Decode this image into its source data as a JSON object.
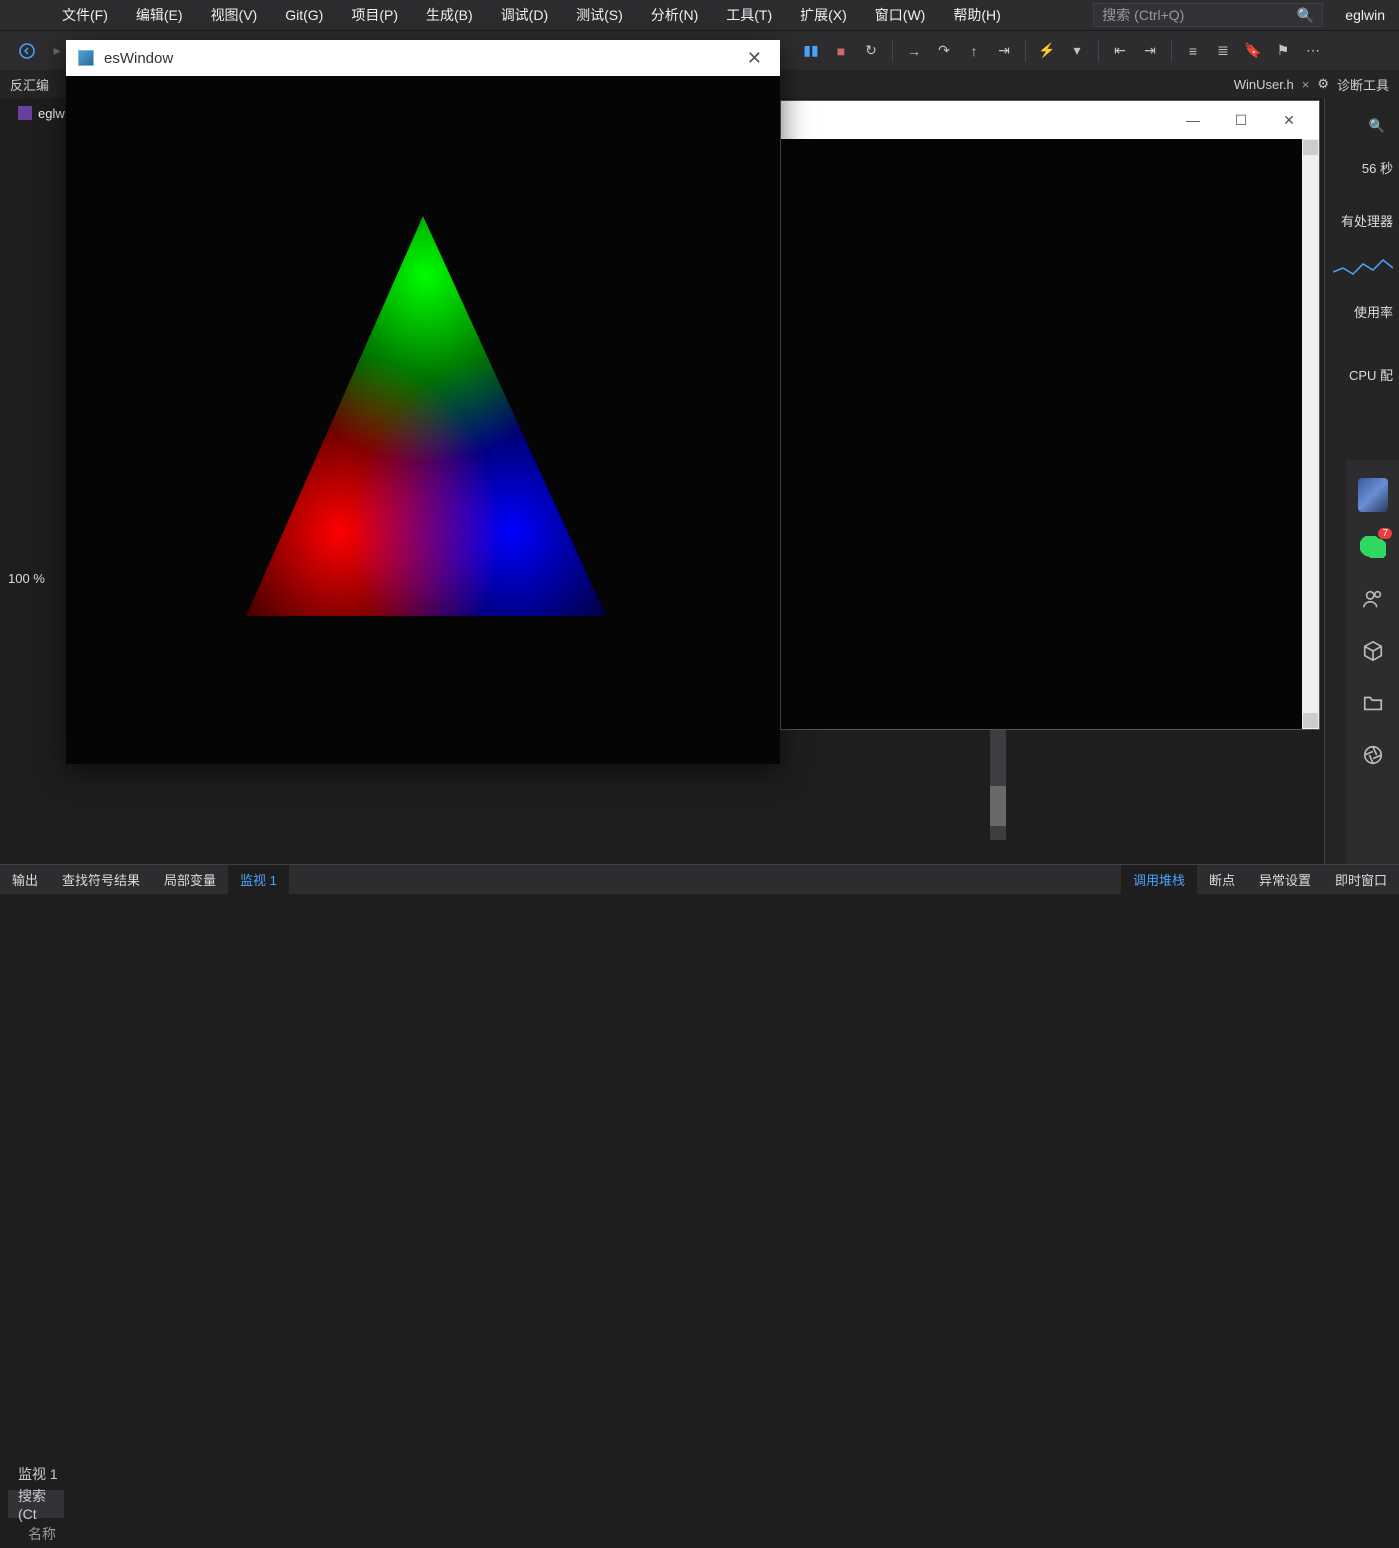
{
  "menubar": {
    "items": [
      "文件(F)",
      "编辑(E)",
      "视图(V)",
      "Git(G)",
      "项目(P)",
      "生成(B)",
      "调试(D)",
      "测试(S)",
      "分析(N)",
      "工具(T)",
      "扩展(X)",
      "窗口(W)",
      "帮助(H)"
    ],
    "search_placeholder": "搜索 (Ctrl+Q)",
    "user": "eglwin"
  },
  "tabbar": {
    "left_label": "反汇编",
    "right_file": "WinUser.h",
    "right_tool": "诊断工具"
  },
  "filetab": {
    "name": "eglw"
  },
  "right_panel": {
    "time": "56 秒",
    "proc": "有处理器",
    "cpu_use": "使用率",
    "cpu_cfg": "CPU 配"
  },
  "pct": "100 %",
  "bottom_left": {
    "watch": "监视 1",
    "search": "搜索(Ct",
    "name": "名称"
  },
  "bottom_strip": {
    "left": [
      "输出",
      "查找符号结果",
      "局部变量",
      "监视 1"
    ],
    "right": [
      "调用堆栈",
      "断点",
      "异常设置",
      "即时窗口"
    ]
  },
  "es_window": {
    "title": "esWindow"
  },
  "dock": {
    "wechat_badge": "7"
  }
}
